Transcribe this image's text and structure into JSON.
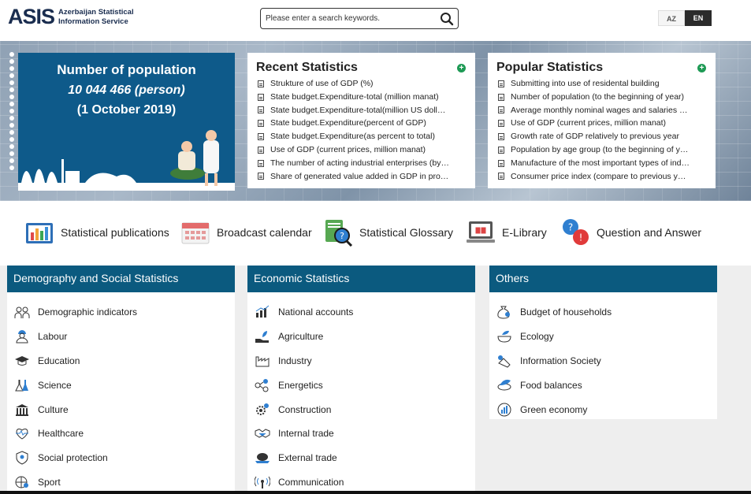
{
  "header": {
    "logo_mark": "ASIS",
    "logo_line1": "Azerbaijan Statistical",
    "logo_line2": "Information Service",
    "search_placeholder": "Please enter a search keywords.",
    "lang_az": "AZ",
    "lang_en": "EN"
  },
  "banner": {
    "pop_title": "Number of population",
    "pop_value": "10 044 466 (person)",
    "pop_date": "(1 October 2019)",
    "recent": {
      "title": "Recent Statistics",
      "items": [
        "Strukture of use of GDP (%)",
        "State budget.Expenditure-total (million manat)",
        "State budget.Expenditure-total(million US dollars)",
        "State budget.Expenditure(percent of GDP)",
        "State budget.Expenditure(as percent to total)",
        "Use of GDP (current prices, million manat)",
        "The number of acting industrial enterprises (by ownership)",
        "Share of generated value added in GDP in processing"
      ]
    },
    "popular": {
      "title": "Popular Statistics",
      "items": [
        "Submitting into use of residental building",
        "Number of population (to the beginning of year)",
        "Average monthly nominal wages and salaries by sectors",
        "Use of GDP (current prices, million manat)",
        "Growth rate of GDP relatively to previous year",
        "Population by age group (to the beginning of year)",
        "Manufacture of the most important types of industrial products",
        "Consumer price index (compare to previous year)"
      ]
    }
  },
  "quick_links": [
    {
      "label": "Statistical publications",
      "icon": "bar-chart-book-icon"
    },
    {
      "label": "Broadcast calendar",
      "icon": "calendar-icon"
    },
    {
      "label": "Statistical Glossary",
      "icon": "glossary-magnifier-icon"
    },
    {
      "label": "E-Library",
      "icon": "laptop-book-icon"
    },
    {
      "label": "Question and Answer",
      "icon": "question-exclamation-icon"
    }
  ],
  "categories": {
    "demography": {
      "title": "Demography and Social Statistics",
      "items": [
        "Demographic indicators",
        "Labour",
        "Education",
        "Science",
        "Culture",
        "Healthcare",
        "Social protection",
        "Sport"
      ]
    },
    "economic": {
      "title": "Economic Statistics",
      "items": [
        "National accounts",
        "Agriculture",
        "Industry",
        "Energetics",
        "Construction",
        "Internal trade",
        "External trade",
        "Communication"
      ]
    },
    "others": {
      "title": "Others",
      "items": [
        "Budget of households",
        "Ecology",
        "Information Society",
        "Food balances",
        "Green economy"
      ]
    }
  },
  "colors": {
    "brand_dark": "#1a2d4f",
    "category_header": "#0b5a7f",
    "population_card": "#0e5a8a",
    "plus_green": "#1e9a55"
  }
}
